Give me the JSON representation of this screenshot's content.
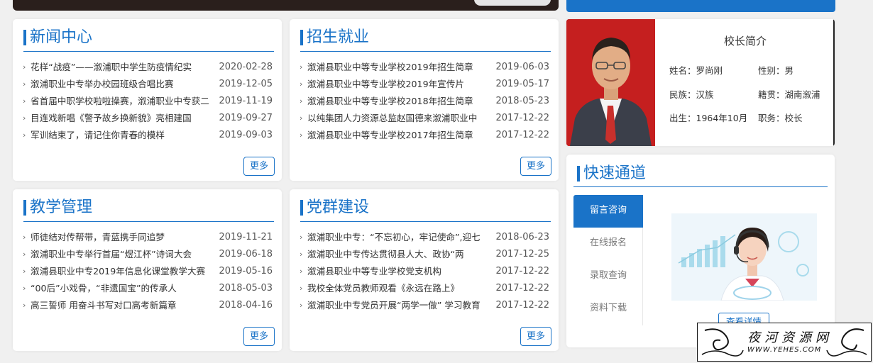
{
  "news_center": {
    "title": "新闻中心",
    "more": "更多",
    "items": [
      {
        "title": "花样“战疫”——溆浦职中学生防疫情纪实",
        "date": "2020-02-28"
      },
      {
        "title": "溆浦职业中专举办校园班级合唱比赛",
        "date": "2019-12-05"
      },
      {
        "title": "省首届中职学校啦啦操赛，溆浦职业中专获二",
        "date": "2019-11-19"
      },
      {
        "title": "目连戏新唱《警予故乡换新貌》亮相建国",
        "date": "2019-09-27"
      },
      {
        "title": "军训结束了，请记住你青春的模样",
        "date": "2019-09-03"
      }
    ]
  },
  "admission": {
    "title": "招生就业",
    "more": "更多",
    "items": [
      {
        "title": "溆浦县职业中等专业学校2019年招生简章",
        "date": "2019-06-03"
      },
      {
        "title": "溆浦县职业中等专业学校2019年宣传片",
        "date": "2019-05-17"
      },
      {
        "title": "溆浦县职业中等专业学校2018年招生简章",
        "date": "2018-05-23"
      },
      {
        "title": "以纯集团人力资源总监赵国德来溆浦职业中",
        "date": "2017-12-22"
      },
      {
        "title": "溆浦县职业中等专业学校2017年招生简章",
        "date": "2017-12-22"
      }
    ]
  },
  "teaching": {
    "title": "教学管理",
    "more": "更多",
    "items": [
      {
        "title": "师徒结对传帮带，青蓝携手同追梦",
        "date": "2019-11-21"
      },
      {
        "title": "溆浦职业中专举行首届“煜江杯”诗词大会",
        "date": "2019-06-18"
      },
      {
        "title": "溆浦县职业中专2019年信息化课堂教学大赛",
        "date": "2019-05-16"
      },
      {
        "title": "“00后”小戏骨，“非遗国宝”的传承人",
        "date": "2018-05-03"
      },
      {
        "title": "高三誓师 用奋斗书写对口高考新篇章",
        "date": "2018-04-16"
      }
    ]
  },
  "party": {
    "title": "党群建设",
    "more": "更多",
    "items": [
      {
        "title": "溆浦职业中专：“不忘初心，牢记使命”,迎七",
        "date": "2018-06-23"
      },
      {
        "title": "溆浦职业中专传达贯彻县人大、政协“两",
        "date": "2017-12-25"
      },
      {
        "title": "溆浦县职业中等专业学校党支机构",
        "date": "2017-12-22"
      },
      {
        "title": "我校全体党员教师观看《永远在路上》",
        "date": "2017-12-22"
      },
      {
        "title": "溆浦职业中专党员开展“两学一做” 学习教育",
        "date": "2017-12-22"
      }
    ]
  },
  "principal": {
    "title": "校长简介",
    "name": "姓名：罗尚刚",
    "gender": "性别：男",
    "ethnicity": "民族：汉族",
    "origin": "籍贯：湖南溆浦",
    "birth": "出生：1964年10月",
    "position": "职务：校长"
  },
  "quick": {
    "title": "快速通道",
    "tabs": [
      "留言咨询",
      "在线报名",
      "录取查询",
      "资料下载"
    ],
    "detail": "查看详情"
  },
  "watermark": {
    "text": "夜河资源网",
    "url": "WWW.YEHES.COM"
  },
  "colors": {
    "accent": "#1a73c8",
    "background": "#f0f0f0",
    "photo_bg": "#c51f1f"
  }
}
